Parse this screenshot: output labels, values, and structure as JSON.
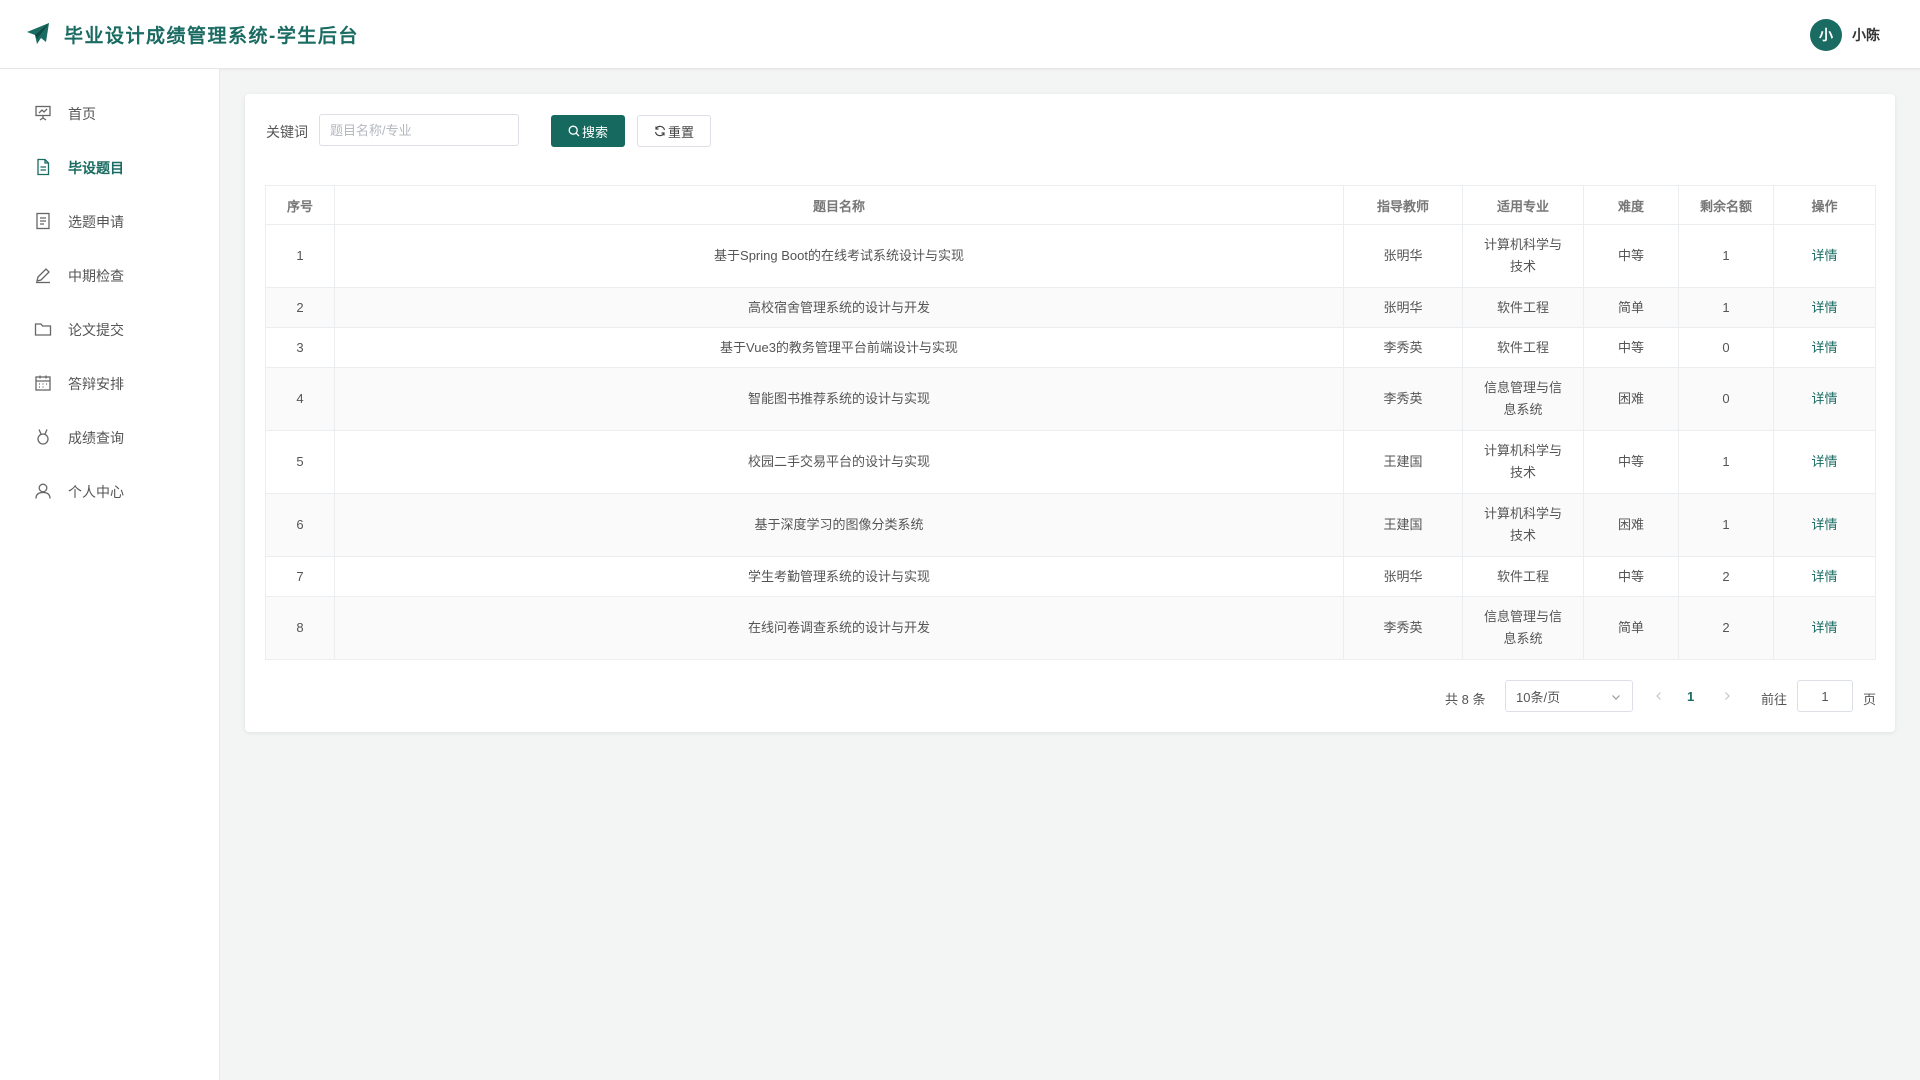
{
  "app": {
    "title": "毕业设计成绩管理系统-学生后台"
  },
  "user": {
    "avatar_text": "小",
    "name": "小陈"
  },
  "colors": {
    "primary": "#1a6b62",
    "button": "#16695f"
  },
  "sidebar": {
    "items": [
      {
        "label": "首页",
        "icon": "presentation-icon",
        "active": false
      },
      {
        "label": "毕设题目",
        "icon": "document-icon",
        "active": true
      },
      {
        "label": "选题申请",
        "icon": "list-document-icon",
        "active": false
      },
      {
        "label": "中期检查",
        "icon": "pen-icon",
        "active": false
      },
      {
        "label": "论文提交",
        "icon": "folder-icon",
        "active": false
      },
      {
        "label": "答辩安排",
        "icon": "calendar-icon",
        "active": false
      },
      {
        "label": "成绩查询",
        "icon": "medal-icon",
        "active": false
      },
      {
        "label": "个人中心",
        "icon": "user-icon",
        "active": false
      }
    ]
  },
  "search": {
    "label": "关键词",
    "placeholder": "题目名称/专业",
    "value": "",
    "search_label": "搜索",
    "reset_label": "重置"
  },
  "table": {
    "headers": [
      "序号",
      "题目名称",
      "指导教师",
      "适用专业",
      "难度",
      "剩余名额",
      "操作"
    ],
    "rows": [
      {
        "no": "1",
        "title": "基于Spring Boot的在线考试系统设计与实现",
        "teacher": "张明华",
        "major_lines": [
          "计算机科学与",
          "技术"
        ],
        "difficulty": "中等",
        "remaining": "1",
        "action": "详情"
      },
      {
        "no": "2",
        "title": "高校宿舍管理系统的设计与开发",
        "teacher": "张明华",
        "major_lines": [
          "软件工程"
        ],
        "difficulty": "简单",
        "remaining": "1",
        "action": "详情"
      },
      {
        "no": "3",
        "title": "基于Vue3的教务管理平台前端设计与实现",
        "teacher": "李秀英",
        "major_lines": [
          "软件工程"
        ],
        "difficulty": "中等",
        "remaining": "0",
        "action": "详情"
      },
      {
        "no": "4",
        "title": "智能图书推荐系统的设计与实现",
        "teacher": "李秀英",
        "major_lines": [
          "信息管理与信",
          "息系统"
        ],
        "difficulty": "困难",
        "remaining": "0",
        "action": "详情"
      },
      {
        "no": "5",
        "title": "校园二手交易平台的设计与实现",
        "teacher": "王建国",
        "major_lines": [
          "计算机科学与",
          "技术"
        ],
        "difficulty": "中等",
        "remaining": "1",
        "action": "详情"
      },
      {
        "no": "6",
        "title": "基于深度学习的图像分类系统",
        "teacher": "王建国",
        "major_lines": [
          "计算机科学与",
          "技术"
        ],
        "difficulty": "困难",
        "remaining": "1",
        "action": "详情"
      },
      {
        "no": "7",
        "title": "学生考勤管理系统的设计与实现",
        "teacher": "张明华",
        "major_lines": [
          "软件工程"
        ],
        "difficulty": "中等",
        "remaining": "2",
        "action": "详情"
      },
      {
        "no": "8",
        "title": "在线问卷调查系统的设计与开发",
        "teacher": "李秀英",
        "major_lines": [
          "信息管理与信",
          "息系统"
        ],
        "difficulty": "简单",
        "remaining": "2",
        "action": "详情"
      }
    ]
  },
  "pagination": {
    "total_text": "共 8 条",
    "page_size": "10条/页",
    "current_page": "1",
    "goto_label": "前往",
    "goto_value": "1",
    "goto_suffix": "页"
  }
}
